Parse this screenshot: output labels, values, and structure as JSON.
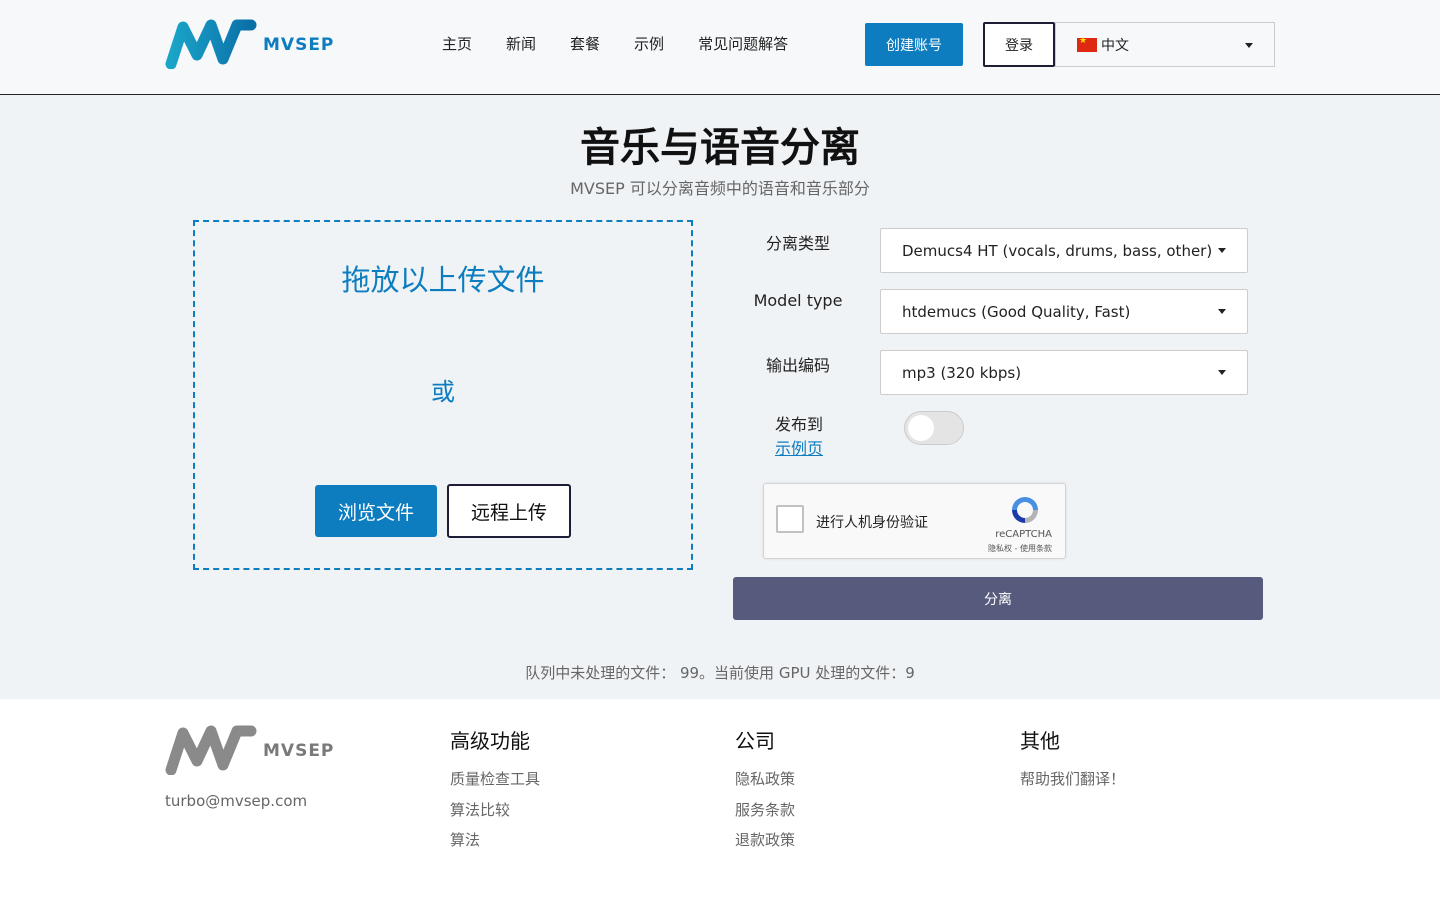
{
  "header": {
    "logo_text": "MVSEP",
    "nav": [
      "主页",
      "新闻",
      "套餐",
      "示例",
      "常见问题解答"
    ],
    "create_account": "创建账号",
    "login": "登录",
    "language": "中文"
  },
  "main": {
    "title": "音乐与语音分离",
    "subtitle": "MVSEP 可以分离音频中的语音和音乐部分",
    "dropzone": {
      "title": "拖放以上传文件",
      "or": "或",
      "browse": "浏览文件",
      "remote": "远程上传"
    },
    "form": {
      "sep_type_label": "分离类型",
      "sep_type_value": "Demucs4 HT (vocals, drums, bass, other)",
      "model_type_label": "Model type",
      "model_type_value": "htdemucs (Good Quality, Fast)",
      "encoding_label": "输出编码",
      "encoding_value": "mp3 (320 kbps)",
      "publish_label": "发布到",
      "publish_link": "示例页",
      "publish_enabled": false
    },
    "captcha": {
      "label": "进行人机身份验证",
      "brand": "reCAPTCHA",
      "links": "隐私权 - 使用条款"
    },
    "separate_button": "分离",
    "queue_text": "队列中未处理的文件： 99。当前使用 GPU 处理的文件：9"
  },
  "footer": {
    "logo_text": "MVSEP",
    "email": "turbo@mvsep.com",
    "columns": [
      {
        "title": "高级功能",
        "links": [
          "质量检查工具",
          "算法比较",
          "算法"
        ]
      },
      {
        "title": "公司",
        "links": [
          "隐私政策",
          "服务条款",
          "退款政策"
        ]
      },
      {
        "title": "其他",
        "links": [
          "帮助我们翻译！"
        ]
      }
    ]
  },
  "colors": {
    "brand_blue": "#0d7dbf",
    "separate_button": "#565a7c",
    "dark_border": "#1d1d35"
  }
}
